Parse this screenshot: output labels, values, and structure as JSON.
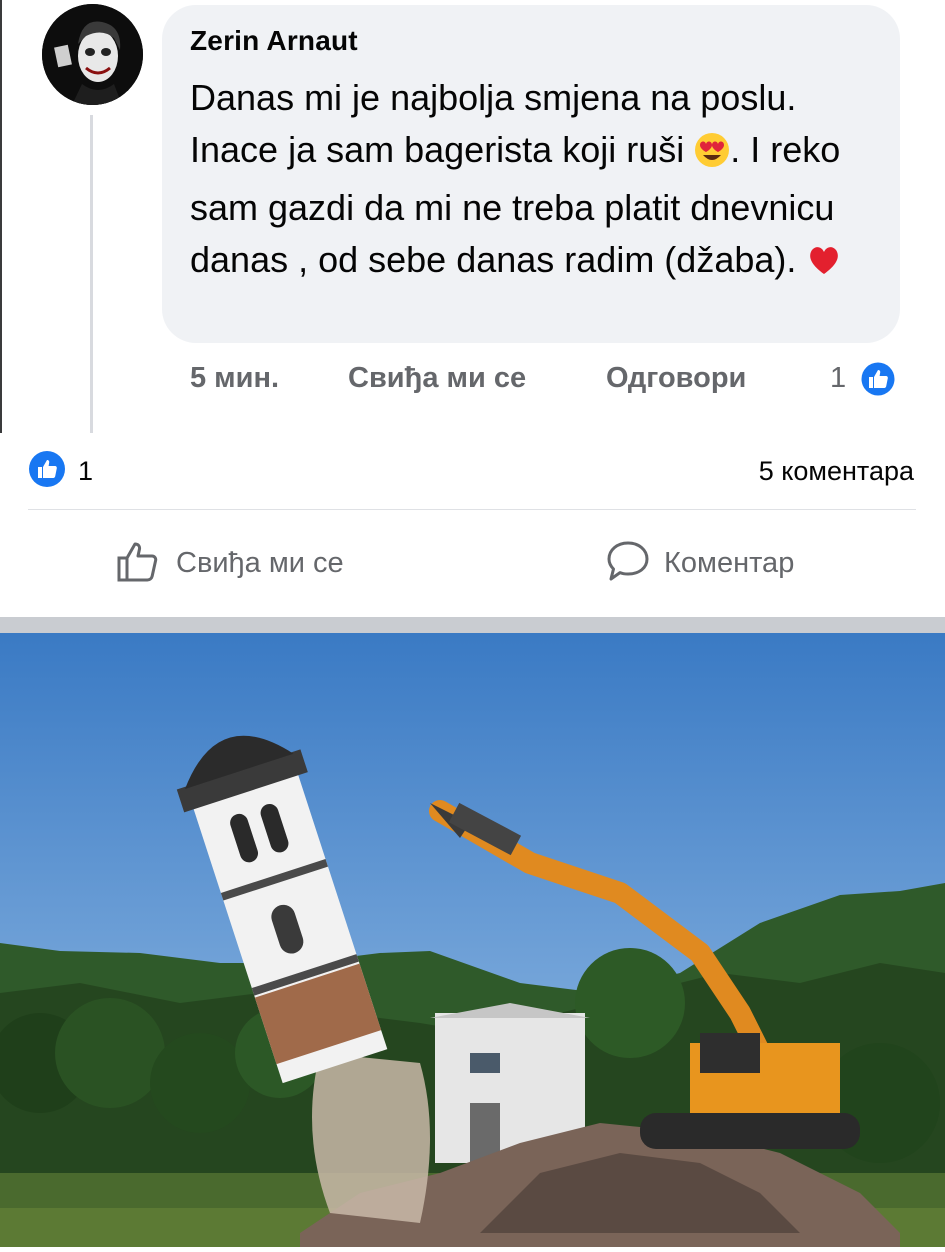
{
  "comment": {
    "author": "Zerin Arnaut",
    "text_part1": "Danas mi je najbolja smjena na poslu. Inace ja sam bagerista koji ruši ",
    "text_part2": ". I reko sam gazdi da mi ne treba platit dnevnicu danas , od sebe danas radim (džaba). ",
    "emoji1": "heart-eyes-emoji",
    "emoji2": "red-heart-emoji",
    "time": "5 мин.",
    "like_label": "Свиђа ми се",
    "reply_label": "Одговори",
    "reaction_count": "1",
    "avatar_icon": "joker-avatar"
  },
  "post": {
    "reaction_count": "1",
    "comments_count": "5 коментара",
    "like_label": "Свиђа ми се",
    "comment_label": "Коментар",
    "photo": "church-tower-demolition-excavator-photo"
  },
  "colors": {
    "bubble": "#f0f2f5",
    "meta_text": "#65676b",
    "like_blue": "#1877f2",
    "sky": "#3f7fc8"
  }
}
